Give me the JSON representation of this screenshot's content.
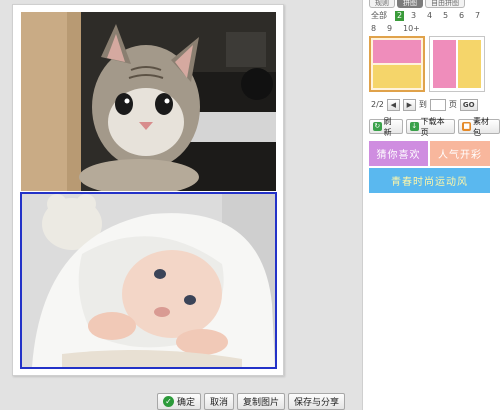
{
  "tabs": [
    {
      "label": "规则",
      "active": false
    },
    {
      "label": "拼图",
      "active": true
    },
    {
      "label": "自由拼图",
      "active": false
    }
  ],
  "count_filter": {
    "all_label": "全部",
    "options": [
      "2",
      "3",
      "4",
      "5",
      "6",
      "7",
      "8",
      "9",
      "10+"
    ],
    "selected": "2"
  },
  "templates": [
    {
      "layout": "vertical",
      "colors": [
        "#ef8dbb",
        "#f5d56a"
      ],
      "selected": true
    },
    {
      "layout": "horizontal",
      "colors": [
        "#ef8dbb",
        "#f5d56a"
      ],
      "selected": false
    }
  ],
  "pager": {
    "current": "2/2",
    "prev_icon": "arrow-left-icon",
    "next_icon": "arrow-right-icon",
    "goto_label": "到",
    "page_unit": "页",
    "go_label": "GO",
    "input_value": ""
  },
  "tools": [
    {
      "label": "刷新",
      "icon": "refresh-icon"
    },
    {
      "label": "下载本页",
      "icon": "download-icon"
    },
    {
      "label": "素材包",
      "icon": "package-icon"
    }
  ],
  "banners": [
    {
      "label": "猜你喜欢",
      "color": "#cf8de0"
    },
    {
      "label": "人气开彩",
      "color": "#f8b79d"
    },
    {
      "label": "青春时尚运动风",
      "color": "#5ab8ef"
    }
  ],
  "actions": {
    "confirm": "确定",
    "cancel": "取消",
    "copy": "复制图片",
    "save_share": "保存与分享"
  },
  "colors": {
    "selection_border": "#2332c8",
    "selected_count": "#3a9b3a",
    "template_highlight": "#e0a24a"
  }
}
